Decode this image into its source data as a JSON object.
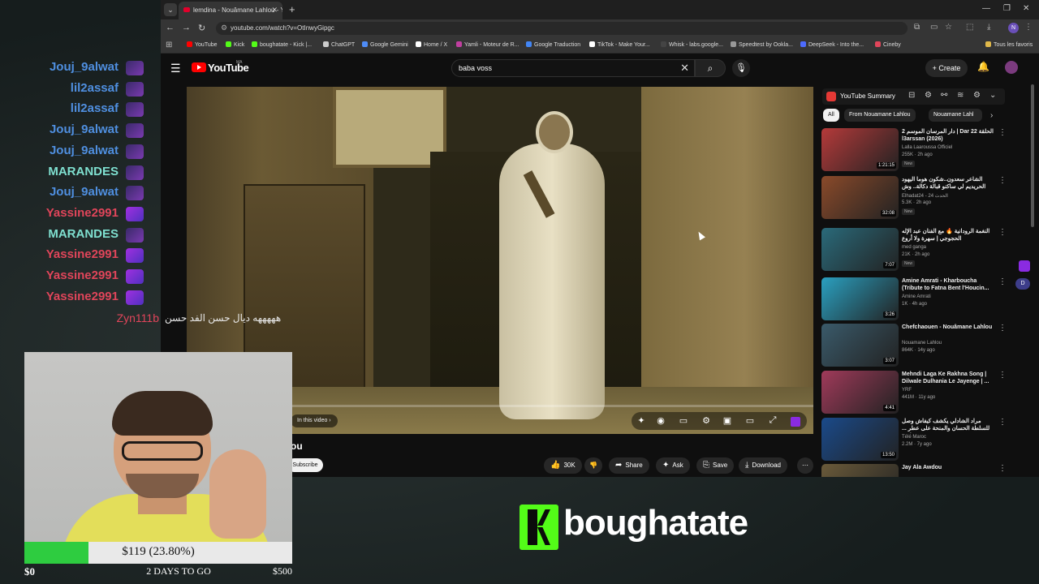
{
  "browser": {
    "tab_title": "lemdina - Nouâmane Lahlou - Y",
    "url": "youtube.com/watch?v=OtInwyGipgc",
    "bookmarks": [
      "YouTube",
      "Kick",
      "boughatate - Kick |...",
      "ChatGPT",
      "Google Gemini",
      "Home / X",
      "Yamli - Moteur de R...",
      "Google Traduction",
      "TikTok - Make Your...",
      "Whisk - labs.google...",
      "Speedtest by Ookla...",
      "DeepSeek - Into the...",
      "Cineby"
    ],
    "all_bookmarks": "Tous les favoris",
    "profile_initial": "N"
  },
  "youtube": {
    "logo_text": "YouTube",
    "region": "MA",
    "search_query": "baba voss",
    "create_label": "Create",
    "video": {
      "in_this_video": "In this video",
      "title_fragment": "ou",
      "subscribe": "Subscribe",
      "likes": "30K",
      "share": "Share",
      "ask": "Ask",
      "save": "Save",
      "download": "Download"
    },
    "sidebar": {
      "summary_title": "YouTube Summary",
      "chips": [
        "All",
        "From Nouamane Lahlou",
        "Nouamane Lahl"
      ],
      "items": [
        {
          "title": "دار المرسان الموسم 2 | Dar 22 الحلقة l3arssan (2026)",
          "channel": "Lalla Laaroussa Officiel",
          "meta": "255K · 2h ago",
          "new": "New",
          "duration": "1:21:15",
          "color": "#b53a3a"
        },
        {
          "title": "الشاعر سعدون..شكون هوما اليهود الحريديم لي ساكنو قبالة دكالة.. وش ريجع مستحيل",
          "channel": "Elhadat24 - 24 الحدث",
          "meta": "5.3K · 2h ago",
          "new": "New",
          "duration": "32:08",
          "color": "#8a4a2a"
        },
        {
          "title": "النغمة الرودانية 🔥 مع الفنان عبد الإله الحجوجي | سهرة ولا أروع",
          "channel": "med ganga",
          "meta": "21K · 2h ago",
          "new": "New",
          "duration": "7:07",
          "color": "#2a6a7a"
        },
        {
          "title": "Amine Amrati - Kharboucha (Tribute to Fatna Bent l'Houcin...",
          "channel": "Amine Amrati",
          "meta": "1K · 4h ago",
          "new": "",
          "duration": "3:26",
          "color": "#2aa0c0"
        },
        {
          "title": "Chefchaouen - Nouâmane Lahlou",
          "channel": "Nouamane Lahlou",
          "meta": "864K · 14y ago",
          "new": "",
          "duration": "3:07",
          "color": "#3a5a6a"
        },
        {
          "title": "Mehndi Laga Ke Rakhna Song | Dilwale Dulhania Le Jayenge | ...",
          "channel": "YRF",
          "meta": "441M · 11y ago",
          "new": "",
          "duration": "4:41",
          "color": "#a03a5a"
        },
        {
          "title": "مراد الشادلي يكشف كيفاش وصل للسلطة الحسان والمنحة على عطر ... مايتيد",
          "channel": "Télé Maroc",
          "meta": "2.2M · 7y ago",
          "new": "",
          "duration": "13:50",
          "color": "#1a4a8a"
        },
        {
          "title": "Jay Ala Awdou",
          "channel": "",
          "meta": "",
          "new": "",
          "duration": "",
          "color": "#6a5a3a"
        }
      ]
    }
  },
  "chat": {
    "lines": [
      {
        "name": "Jouj_9alwat",
        "color": "#4f8fe0"
      },
      {
        "name": "lil2assaf",
        "color": "#4f8fe0"
      },
      {
        "name": "lil2assaf",
        "color": "#4f8fe0"
      },
      {
        "name": "Jouj_9alwat",
        "color": "#4f8fe0"
      },
      {
        "name": "Jouj_9alwat",
        "color": "#4f8fe0"
      },
      {
        "name": "MARANDES",
        "color": "#7fe0d0"
      },
      {
        "name": "Jouj_9alwat",
        "color": "#4f8fe0"
      },
      {
        "name": "Yassine2991",
        "color": "#e0455a"
      },
      {
        "name": "MARANDES",
        "color": "#7fe0d0"
      },
      {
        "name": "Yassine2991",
        "color": "#e0455a"
      },
      {
        "name": "Yassine2991",
        "color": "#e0455a"
      },
      {
        "name": "Yassine2991",
        "color": "#e0455a"
      }
    ],
    "last_user": "Zyn111b",
    "last_user_color": "#e0455a",
    "last_message": "هههههه ديال حسن الفد حسن"
  },
  "goal": {
    "label": "$119 (23.80%)",
    "progress_fraction": 0.238,
    "min": "$0",
    "days_left": "2 DAYS TO GO",
    "max": "$500"
  },
  "brand": {
    "name": "boughatate",
    "color": "#53fc18"
  }
}
